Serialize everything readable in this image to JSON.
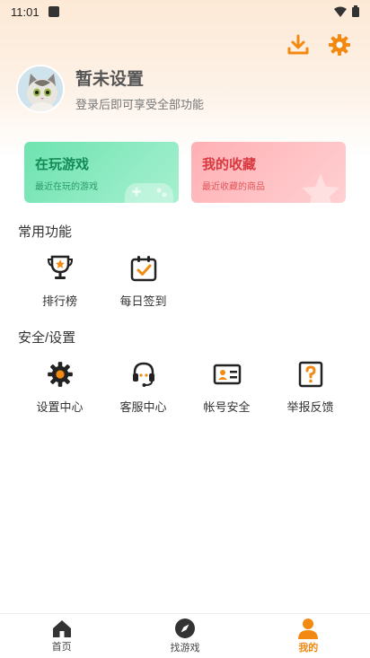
{
  "status_bar": {
    "time": "11:01"
  },
  "profile": {
    "name": "暂未设置",
    "subtitle": "登录后即可享受全部功能"
  },
  "cards": [
    {
      "title": "在玩游戏",
      "subtitle": "最近在玩的游戏"
    },
    {
      "title": "我的收藏",
      "subtitle": "最近收藏的商品"
    }
  ],
  "common": {
    "title": "常用功能",
    "items": [
      {
        "label": "排行榜",
        "icon": "trophy-icon"
      },
      {
        "label": "每日签到",
        "icon": "calendar-check-icon"
      }
    ]
  },
  "settings": {
    "title": "安全/设置",
    "items": [
      {
        "label": "设置中心",
        "icon": "gear-icon"
      },
      {
        "label": "客服中心",
        "icon": "headset-icon"
      },
      {
        "label": "帐号安全",
        "icon": "id-card-icon"
      },
      {
        "label": "举报反馈",
        "icon": "question-icon"
      }
    ]
  },
  "tabbar": {
    "tabs": [
      {
        "label": "首页",
        "icon": "home-icon",
        "active": false
      },
      {
        "label": "找游戏",
        "icon": "compass-icon",
        "active": false
      },
      {
        "label": "我的",
        "icon": "user-icon",
        "active": true
      }
    ]
  },
  "colors": {
    "accent": "#f28a12",
    "green": "#128a56",
    "red": "#d8393f"
  }
}
